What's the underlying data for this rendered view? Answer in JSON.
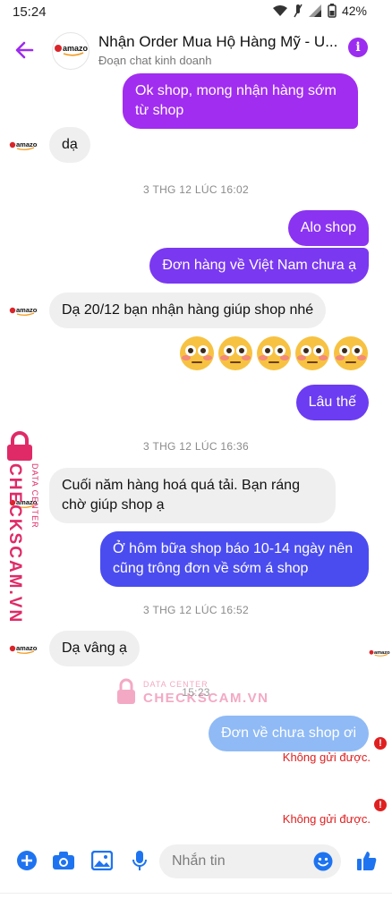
{
  "status_bar": {
    "time": "15:24",
    "battery": "42%"
  },
  "header": {
    "title": "Nhận Order Mua Hộ Hàng Mỹ - U...",
    "subtitle": "Đoạn chat kinh doanh",
    "avatar_text": "amazon",
    "info_label": "i"
  },
  "messages": {
    "m1": "Ok shop, mong nhận hàng sớm từ shop",
    "m2": "dạ",
    "ts1": "3 THG 12 LÚC 16:02",
    "m3": "Alo shop",
    "m4": "Đơn hàng về Việt Nam chưa ạ",
    "m5": "Dạ 20/12 bạn nhận hàng giúp shop nhé",
    "m6": "Lâu thế",
    "ts2": "3 THG 12 LÚC 16:36",
    "m7": "Cuối năm hàng hoá quá tải. Bạn ráng chờ giúp shop ạ",
    "m8": "Ở hôm bữa shop báo 10-14 ngày nên cũng trông đơn về sớm á shop",
    "ts3": "3 THG 12 LÚC 16:52",
    "m9": "Dạ vâng ạ",
    "ts4": "15:23",
    "m10": "Đơn về chưa shop ơi",
    "err1": "Không gửi được.",
    "err2": "Không gửi được."
  },
  "watermark": {
    "small": "DATA CENTER",
    "brand": "CHECKSCAM.VN"
  },
  "avatar_label": "amazon",
  "composer": {
    "placeholder": "Nhắn tin"
  },
  "colors": {
    "accent": "#9b2cf0",
    "bubble_top": "#a12df0",
    "bubble_mid": "#6b3cf2",
    "bubble_bottom": "#4a4cf0",
    "bubble_pending": "#8fbaf5",
    "error": "#e02020",
    "composer_icon": "#1e74f0"
  }
}
